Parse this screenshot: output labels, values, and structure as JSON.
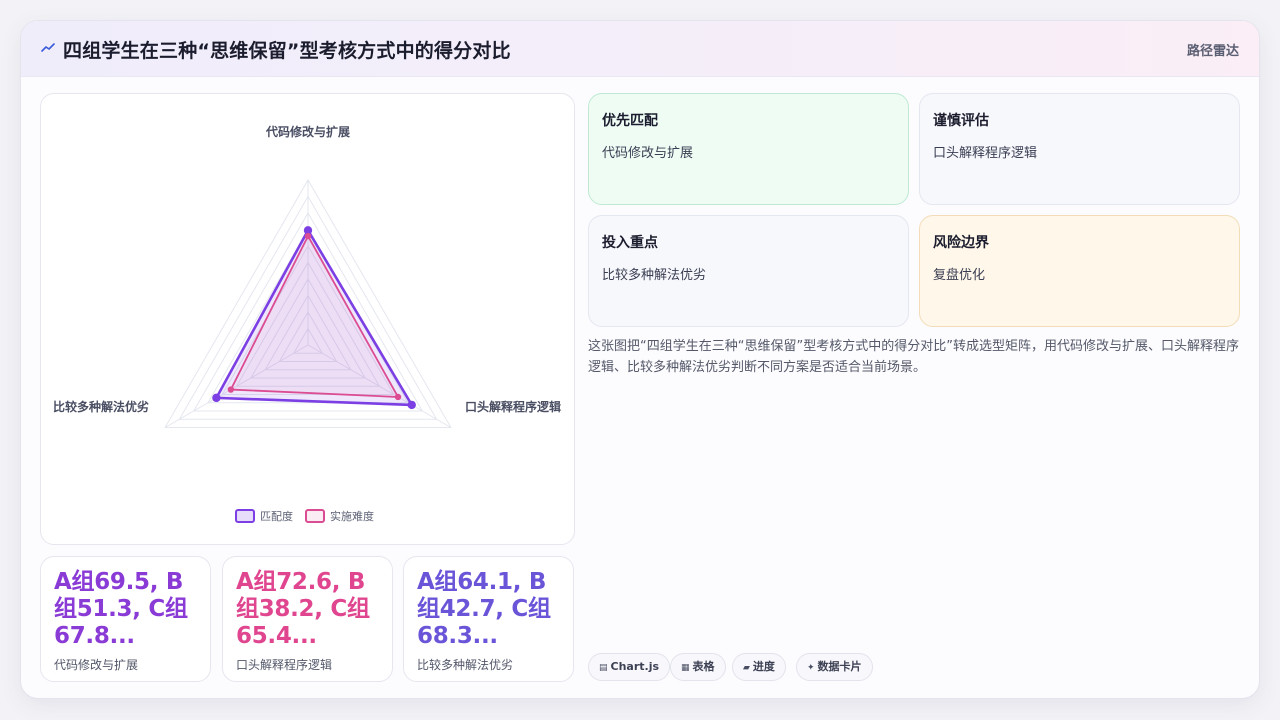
{
  "header": {
    "title": "四组学生在三种“思维保留”型考核方式中的得分对比",
    "chart_kind": "路径雷达",
    "icon": "trend-line-icon"
  },
  "chart_data": {
    "type": "radar",
    "axes": [
      "代码修改与扩展",
      "口头解释程序逻辑",
      "比较多种解法优劣"
    ],
    "rlim": [
      0,
      100
    ],
    "grid": true,
    "legend_position": "bottom",
    "series": [
      {
        "name": "匹配度",
        "values": [
          69.5,
          72.6,
          64.1
        ],
        "color": "#7b3fe4"
      },
      {
        "name": "实施难度",
        "values": [
          66,
          63,
          54
        ],
        "color": "#db4c92"
      }
    ]
  },
  "stats": [
    {
      "value": "A组69.5, B组51.3, C组67.8...",
      "label": "代码修改与扩展",
      "color": "#8a3bd6"
    },
    {
      "value": "A组72.6, B组38.2, C组65.4...",
      "label": "口头解释程序逻辑",
      "color": "#e0468f"
    },
    {
      "value": "A组64.1, B组42.7, C组68.3...",
      "label": "比较多种解法优劣",
      "color": "#6a55d8"
    }
  ],
  "cards": [
    {
      "title": "优先匹配",
      "subtitle": "代码修改与扩展",
      "bg": "#eefcf4",
      "border": "#bfe9d2"
    },
    {
      "title": "谨慎评估",
      "subtitle": "口头解释程序逻辑",
      "bg": "#f7f8fc",
      "border": "#e4e6f0"
    },
    {
      "title": "投入重点",
      "subtitle": "比较多种解法优劣",
      "bg": "#f7f8fc",
      "border": "#e4e6f0"
    },
    {
      "title": "风险边界",
      "subtitle": "复盘优化",
      "bg": "#fff7ea",
      "border": "#f2ddb8"
    }
  ],
  "description": "这张图把“四组学生在三种“思维保留”型考核方式中的得分对比”转成选型矩阵，用代码修改与扩展、口头解释程序逻辑、比较多种解法优劣判断不同方案是否适合当前场景。",
  "tags": [
    {
      "icon": "▤",
      "label": "Chart.js"
    },
    {
      "icon": "▦",
      "label": "表格"
    },
    {
      "icon": "▰",
      "label": "进度"
    },
    {
      "icon": "✦",
      "label": "数据卡片"
    }
  ]
}
